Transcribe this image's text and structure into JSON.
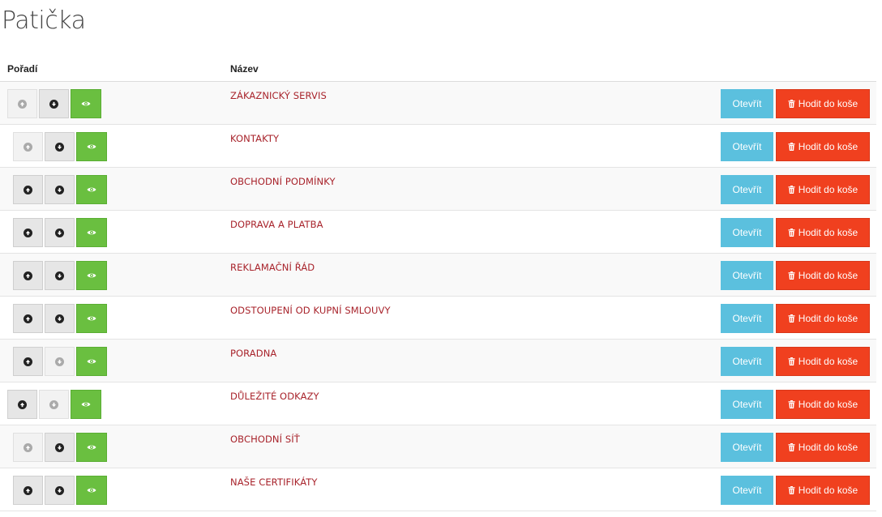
{
  "page": {
    "title": "Patička"
  },
  "table": {
    "headers": {
      "order": "Pořadí",
      "name": "Název"
    },
    "open_label": "Otevřít",
    "trash_label": "Hodit do koše",
    "rows": [
      {
        "name": "ZÁKAZNICKÝ SERVIS",
        "up_enabled": false,
        "down_enabled": true,
        "visible": true
      },
      {
        "name": "KONTAKTY",
        "up_enabled": false,
        "down_enabled": true,
        "visible": true
      },
      {
        "name": "OBCHODNÍ PODMÍNKY",
        "up_enabled": true,
        "down_enabled": true,
        "visible": true
      },
      {
        "name": "DOPRAVA A PLATBA",
        "up_enabled": true,
        "down_enabled": true,
        "visible": true
      },
      {
        "name": "REKLAMAČNÍ ŘÁD",
        "up_enabled": true,
        "down_enabled": true,
        "visible": true
      },
      {
        "name": "ODSTOUPENÍ OD KUPNÍ SMLOUVY",
        "up_enabled": true,
        "down_enabled": true,
        "visible": true
      },
      {
        "name": "PORADNA",
        "up_enabled": true,
        "down_enabled": false,
        "visible": true
      },
      {
        "name": "DŮLEŽITÉ ODKAZY",
        "up_enabled": true,
        "down_enabled": false,
        "visible": true
      },
      {
        "name": "OBCHODNÍ SÍŤ",
        "up_enabled": false,
        "down_enabled": true,
        "visible": true
      },
      {
        "name": "NAŠE CERTIFIKÁTY",
        "up_enabled": true,
        "down_enabled": true,
        "visible": true
      }
    ]
  },
  "colors": {
    "link": "#a8232b",
    "open_button": "#5bc0de",
    "trash_button": "#f0401f",
    "visible_button": "#6abf40"
  },
  "icons": {
    "move_up": "arrow-up-circle-icon",
    "move_down": "arrow-down-circle-icon",
    "visibility": "eye-icon",
    "trash": "trash-icon"
  }
}
